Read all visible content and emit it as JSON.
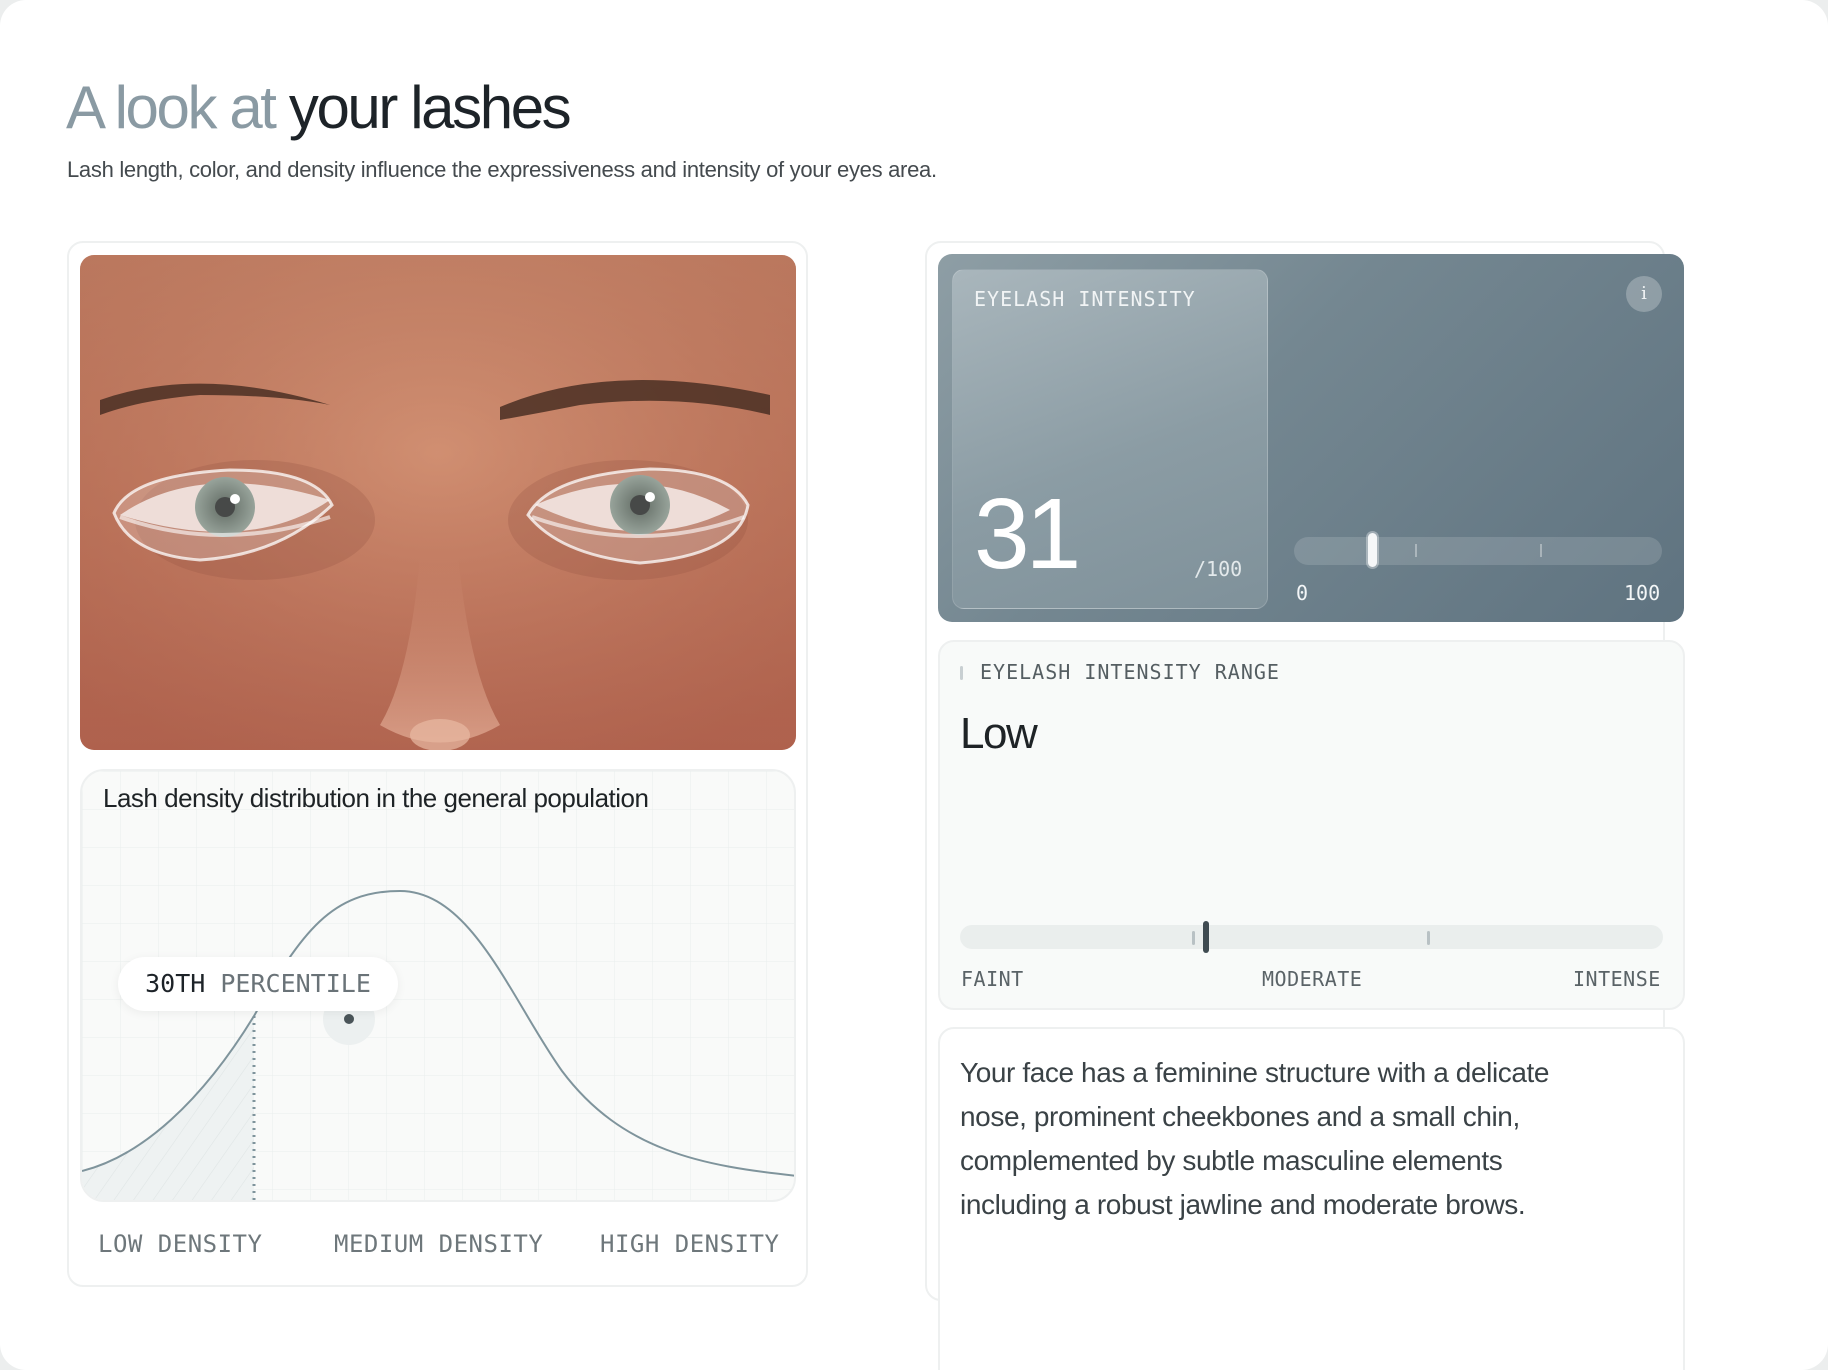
{
  "header": {
    "title_light": "A look at",
    "title_dark": "your lashes",
    "subtitle": "Lash length, color, and density influence the expressiveness and intensity of your eyes area."
  },
  "distribution": {
    "title": "Lash density distribution in the general population",
    "percentile_number": "30TH",
    "percentile_word": "PERCENTILE",
    "percentile_value": 30,
    "axis_labels": [
      "LOW DENSITY",
      "MEDIUM DENSITY",
      "HIGH DENSITY"
    ]
  },
  "eyelash_intensity": {
    "label": "EYELASH INTENSITY",
    "score": "31",
    "max": "/100",
    "info_icon": "info-icon",
    "info_glyph": "i",
    "scale_min": "0",
    "scale_max": "100",
    "slider_value": 31
  },
  "intensity_range": {
    "label": "EYELASH INTENSITY RANGE",
    "value": "Low",
    "scale": [
      "FAINT",
      "MODERATE",
      "INTENSE"
    ]
  },
  "description": {
    "text": "Your face has a feminine structure with a delicate nose, prominent cheekbones and a small chin, complemented by subtle masculine elements including a robust jawline and moderate brows."
  },
  "colors": {
    "accent_dark": "#1d2328",
    "accent_light": "#8a9aa3",
    "curve": "#7f949c",
    "card_gradient_start": "#8e9ea5",
    "card_gradient_end": "#5f7380"
  }
}
